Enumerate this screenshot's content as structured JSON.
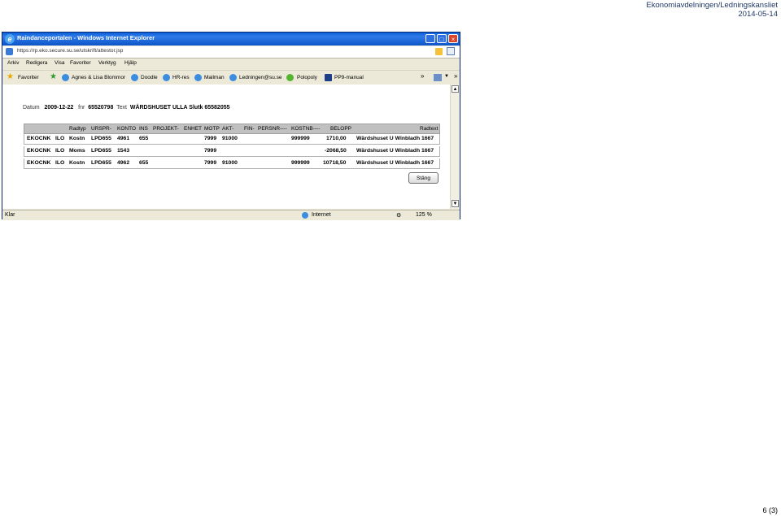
{
  "doc": {
    "department": "Ekonomiavdelningen/Ledningskansliet",
    "date": "2014-05-14",
    "page": "6 (3)"
  },
  "window": {
    "title": "Raindanceportalen - Windows Internet Explorer",
    "address": "https://rp.eko.secure.su.se/utskrift/attestor.jsp"
  },
  "menu": [
    "Arkiv",
    "Redigera",
    "Visa",
    "Favoriter",
    "Verktyg",
    "Hjälp"
  ],
  "favorites": {
    "label": "Favoriter",
    "links": [
      "Agnes & Lisa Blommor",
      "Doodle",
      "HR-res",
      "Mailman",
      "Ledningen@su.se",
      "Polopoly",
      "PP9-manual"
    ]
  },
  "record": {
    "datum_label": "Datum",
    "datum": "2009-12-22",
    "fnr_label": "fnr",
    "fnr": "65520798",
    "text_label": "Text",
    "text": "WÄRDSHUSET ULLA Slutk 65582055"
  },
  "table": {
    "headers": [
      "Radtyp",
      "URSPR-",
      "KONTO",
      "INS",
      "PROJEKT-",
      "ENHET",
      "MOTP",
      "AKT-",
      "FIN-",
      "PERSNR----",
      "KOSTNB----",
      "BELOPP",
      "Radtext"
    ],
    "rows": [
      {
        "c1": "EKOCNK",
        "c2": "ILO",
        "c3": "Kostn",
        "c4": "LPD655",
        "c5": "4961",
        "c6": "655",
        "c7": "7999",
        "c8": "91000",
        "c9": "999999",
        "c10": "1710,00",
        "c11": "Wärdshuset U Winbladh 1667"
      },
      {
        "c1": "EKOCNK",
        "c2": "ILO",
        "c3": "Moms",
        "c4": "LPD655",
        "c5": "1543",
        "c6": "",
        "c7": "7999",
        "c8": "",
        "c9": "",
        "c10": "-2068,50",
        "c11": "Wärdshuset U Winbladh 1667"
      },
      {
        "c1": "EKOCNK",
        "c2": "ILO",
        "c3": "Kostn",
        "c4": "LPD655",
        "c5": "4962",
        "c6": "655",
        "c7": "7999",
        "c8": "91000",
        "c9": "999999",
        "c10": "10718,50",
        "c11": "Wärdshuset U Winbladh 1667"
      }
    ],
    "close_label": "Stäng"
  },
  "status": {
    "left": "Klar",
    "zone": "Internet",
    "zoom": "125 %"
  },
  "icons": {
    "ie": "ie-icon",
    "star": "favorites-star-icon",
    "home": "home-icon"
  }
}
